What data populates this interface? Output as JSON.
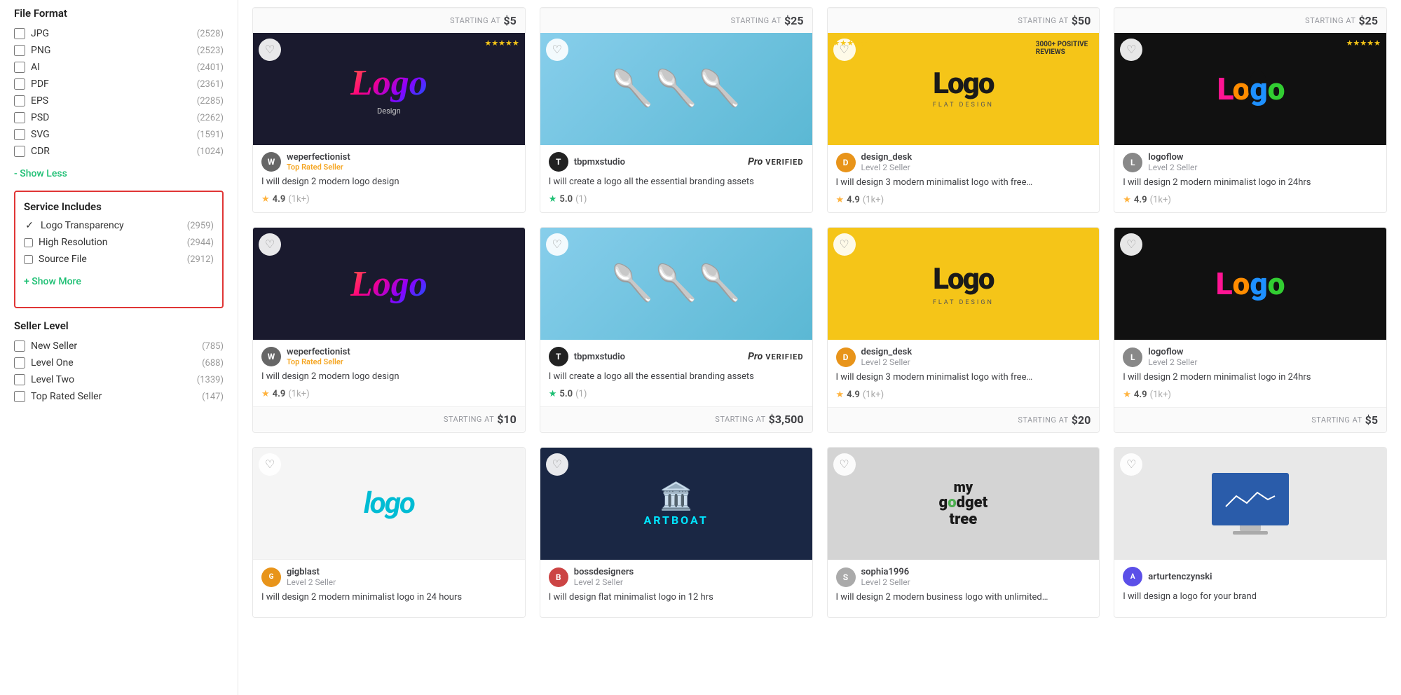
{
  "sidebar": {
    "file_format": {
      "title": "File Format",
      "items": [
        {
          "label": "JPG",
          "count": "2528",
          "checked": false
        },
        {
          "label": "PNG",
          "count": "2523",
          "checked": false
        },
        {
          "label": "AI",
          "count": "2401",
          "checked": false
        },
        {
          "label": "PDF",
          "count": "2361",
          "checked": false
        },
        {
          "label": "EPS",
          "count": "2285",
          "checked": false
        },
        {
          "label": "PSD",
          "count": "2262",
          "checked": false
        },
        {
          "label": "SVG",
          "count": "1591",
          "checked": false
        },
        {
          "label": "CDR",
          "count": "1024",
          "checked": false
        }
      ],
      "show_less_label": "- Show Less"
    },
    "service_includes": {
      "title": "Service Includes",
      "items": [
        {
          "label": "Logo Transparency",
          "count": "2959",
          "checked": true
        },
        {
          "label": "High Resolution",
          "count": "2944",
          "checked": false
        },
        {
          "label": "Source File",
          "count": "2912",
          "checked": false
        }
      ],
      "show_more_label": "+ Show More"
    },
    "seller_level": {
      "title": "Seller Level",
      "items": [
        {
          "label": "New Seller",
          "count": "785",
          "checked": false
        },
        {
          "label": "Level One",
          "count": "688",
          "checked": false
        },
        {
          "label": "Level Two",
          "count": "1339",
          "checked": false
        },
        {
          "label": "Top Rated Seller",
          "count": "147",
          "checked": false
        }
      ]
    }
  },
  "gigs": {
    "rows": [
      {
        "cards": [
          {
            "id": "weperfectionist",
            "price": "$5",
            "price_label": "STARTING AT",
            "seller_name": "weperfectionist",
            "seller_level": "Top Rated Seller",
            "seller_level_type": "top",
            "title": "I will design 2 modern logo design",
            "rating": "4.9",
            "rating_count": "(1k+)",
            "avatar_color": "#555",
            "avatar_initials": "W",
            "image_type": "logo-dark",
            "image_text": "Logo"
          },
          {
            "id": "tbpmxstudio",
            "price": "$25",
            "price_label": "STARTING AT",
            "seller_name": "tbpmxstudio",
            "seller_level": "",
            "seller_level_type": "pro",
            "title": "I will create a logo all the essential branding assets",
            "rating": "5.0",
            "rating_count": "(1)",
            "avatar_color": "#222",
            "avatar_initials": "T",
            "image_type": "logo-colorful",
            "image_text": "🥄"
          },
          {
            "id": "design_desk",
            "price": "$50",
            "price_label": "STARTING AT",
            "seller_name": "design_desk",
            "seller_level": "Level 2 Seller",
            "seller_level_type": "level2",
            "title": "I will design 3 modern minimalist logo with free…",
            "rating": "4.9",
            "rating_count": "(1k+)",
            "avatar_color": "#e8941a",
            "avatar_initials": "D",
            "image_type": "logo-yellow",
            "image_text": "Logo"
          },
          {
            "id": "logoflow",
            "price": "$25",
            "price_label": "STARTING AT",
            "seller_name": "logoflow",
            "seller_level": "Level 2 Seller",
            "seller_level_type": "level2",
            "title": "I will design 2 modern minimalist logo in 24hrs",
            "rating": "4.9",
            "rating_count": "(1k+)",
            "avatar_color": "#888",
            "avatar_initials": "L",
            "image_type": "logo-black",
            "image_text": "Logo"
          }
        ]
      },
      {
        "cards": [
          {
            "id": "weperfectionist-2",
            "price": "$10",
            "price_label": "STARTING AT",
            "seller_name": "weperfectionist",
            "seller_level": "Top Rated Seller",
            "seller_level_type": "top",
            "title": "I will design 2 modern logo design",
            "rating": "4.9",
            "rating_count": "(1k+)",
            "avatar_color": "#555",
            "avatar_initials": "W",
            "image_type": "logo-dark",
            "image_text": "Logo"
          },
          {
            "id": "tbpmxstudio-2",
            "price": "$3,500",
            "price_label": "STARTING AT",
            "seller_name": "tbpmxstudio",
            "seller_level": "",
            "seller_level_type": "pro",
            "title": "I will create a logo all the essential branding assets",
            "rating": "5.0",
            "rating_count": "(1)",
            "avatar_color": "#222",
            "avatar_initials": "T",
            "image_type": "logo-colorful",
            "image_text": "🥄"
          },
          {
            "id": "design_desk-2",
            "price": "$20",
            "price_label": "STARTING AT",
            "seller_name": "design_desk",
            "seller_level": "Level 2 Seller",
            "seller_level_type": "level2",
            "title": "I will design 3 modern minimalist logo with free…",
            "rating": "4.9",
            "rating_count": "(1k+)",
            "avatar_color": "#e8941a",
            "avatar_initials": "D",
            "image_type": "logo-yellow",
            "image_text": "Logo"
          },
          {
            "id": "logoflow-2",
            "price": "$5",
            "price_label": "STARTING AT",
            "seller_name": "logoflow",
            "seller_level": "Level 2 Seller",
            "seller_level_type": "level2",
            "title": "I will design 2 modern minimalist logo in 24hrs",
            "rating": "4.9",
            "rating_count": "(1k+)",
            "avatar_color": "#888",
            "avatar_initials": "L",
            "image_type": "logo-black",
            "image_text": "Logo"
          }
        ]
      },
      {
        "cards": [
          {
            "id": "gigblast",
            "price": "",
            "price_label": "",
            "seller_name": "gigblast",
            "seller_level": "Level 2 Seller",
            "seller_level_type": "level2",
            "title": "I will design 2 modern minimalist logo in 24 hours",
            "rating": "",
            "rating_count": "",
            "avatar_color": "#e8941a",
            "avatar_initials": "G",
            "image_type": "logo-teal",
            "image_text": "logo"
          },
          {
            "id": "bossdesigners",
            "price": "",
            "price_label": "",
            "seller_name": "bossdesigners",
            "seller_level": "Level 2 Seller",
            "seller_level_type": "level2",
            "title": "I will design flat minimalist logo in 12 hrs",
            "rating": "",
            "rating_count": "",
            "avatar_color": "#cc4444",
            "avatar_initials": "B",
            "image_type": "logo-artboat",
            "image_text": "ARTBOAT"
          },
          {
            "id": "sophia1996",
            "price": "",
            "price_label": "",
            "seller_name": "sophia1996",
            "seller_level": "Level 2 Seller",
            "seller_level_type": "level2",
            "title": "I will design 2 modern business logo with unlimited…",
            "rating": "",
            "rating_count": "",
            "avatar_color": "#aaa",
            "avatar_initials": "S",
            "image_type": "logo-nature",
            "image_text": "my gadget tree"
          },
          {
            "id": "arturtenczynski",
            "price": "",
            "price_label": "",
            "seller_name": "arturtenczynski",
            "seller_level": "",
            "seller_level_type": "none",
            "title": "I will design a logo for your brand",
            "rating": "",
            "rating_count": "",
            "avatar_color": "#5b4fe8",
            "avatar_initials": "A",
            "image_type": "logo-screen",
            "image_text": "screen"
          }
        ]
      }
    ]
  }
}
